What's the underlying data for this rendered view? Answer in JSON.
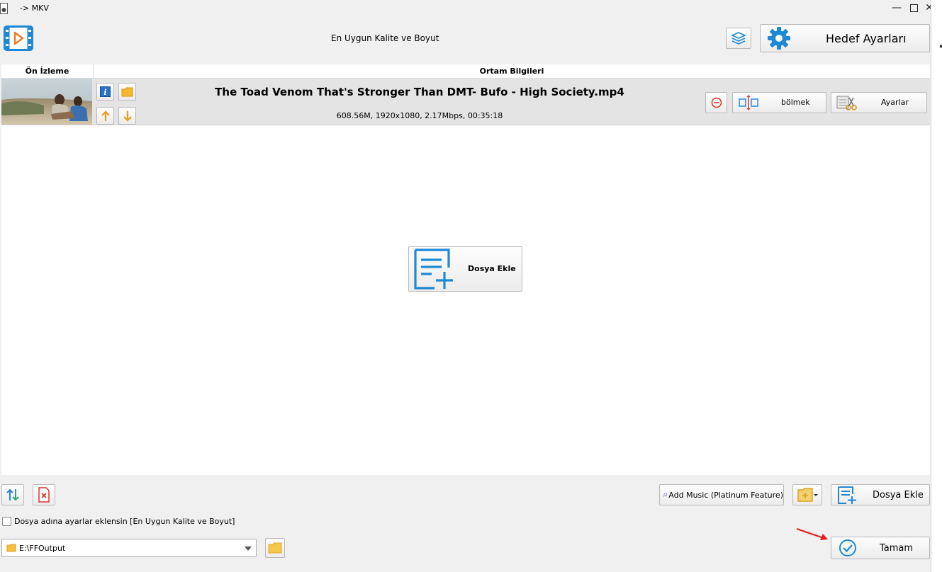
{
  "window": {
    "title": "-> MKV"
  },
  "header": {
    "preset_label": "En Uygun Kalite ve Boyut",
    "target_settings_label": "Hedef Ayarları"
  },
  "columns": {
    "preview": "Ön İzleme",
    "media_info": "Ortam Bilgileri"
  },
  "file": {
    "name": "The Toad Venom That's Stronger Than DMT- Bufo - High Society.mp4",
    "info": "608.56M, 1920x1080, 2.17Mbps, 00:35:18",
    "split_label": "bölmek",
    "settings_label": "Ayarlar"
  },
  "center": {
    "add_file_label": "Dosya Ekle"
  },
  "bottom": {
    "add_music_label": "Add Music (Platinum Feature)",
    "add_file_label": "Dosya Ekle",
    "append_settings_label": "Dosya adına ayarlar eklensin [En Uygun Kalite ve Boyut]",
    "output_path": "E:\\FFOutput",
    "ok_label": "Tamam"
  },
  "colors": {
    "accent_blue": "#1e88d6",
    "orange": "#f0a020",
    "red": "#e03030"
  }
}
